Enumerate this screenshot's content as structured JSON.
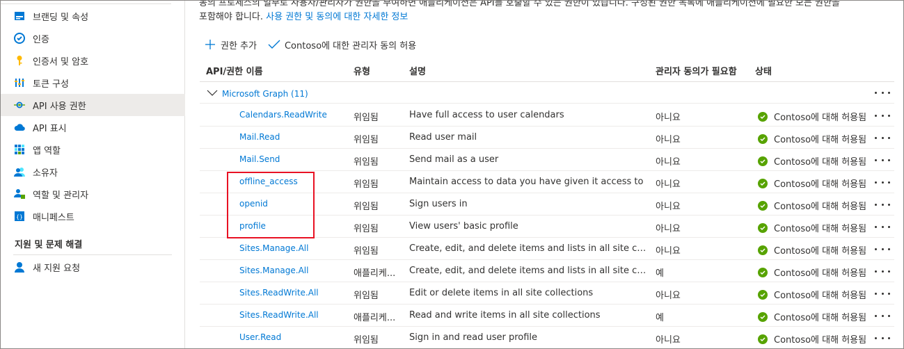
{
  "sidebar": {
    "items": [
      {
        "label": "브랜딩 및 속성",
        "icon": "branding-icon"
      },
      {
        "label": "인증",
        "icon": "authentication-icon"
      },
      {
        "label": "인증서 및 암호",
        "icon": "key-icon"
      },
      {
        "label": "토큰 구성",
        "icon": "token-configuration-icon"
      },
      {
        "label": "API 사용 권한",
        "icon": "api-permissions-icon",
        "selected": true
      },
      {
        "label": "API 표시",
        "icon": "expose-api-icon"
      },
      {
        "label": "앱 역할",
        "icon": "app-roles-icon"
      },
      {
        "label": "소유자",
        "icon": "owners-icon"
      },
      {
        "label": "역할 및 관리자",
        "icon": "roles-admins-icon"
      },
      {
        "label": "매니페스트",
        "icon": "manifest-icon"
      }
    ],
    "support_section": "지원 및 문제 해결",
    "support_items": [
      {
        "label": "새 지원 요청",
        "icon": "support-request-icon"
      }
    ]
  },
  "main": {
    "description_line1": "동의 프로세스의 일부로 사용자/관리자가 권한을 부여하면 애플리케이션은 API를 호출할 수 있는 권한이 있습니다. 구성된 권한 목록에 애플리케이션에 필요한 모든 권한을",
    "description_line2": "포함해야 합니다.",
    "description_link": "사용 권한 및 동의에 대한 자세한 정보",
    "toolbar": {
      "add_permission": "권한 추가",
      "grant_consent": "Contoso에 대한 관리자 동의 허용"
    },
    "columns": {
      "name": "API/권한 이름",
      "type": "유형",
      "description": "설명",
      "admin_consent": "관리자 동의가 필요함",
      "status": "상태"
    },
    "group": {
      "label": "Microsoft Graph (11)"
    },
    "rows": [
      {
        "name": "Calendars.ReadWrite",
        "type": "위임됨",
        "description": "Have full access to user calendars",
        "admin": "아니요",
        "status": "Contoso에 대해 허용됨"
      },
      {
        "name": "Mail.Read",
        "type": "위임됨",
        "description": "Read user mail",
        "admin": "아니요",
        "status": "Contoso에 대해 허용됨"
      },
      {
        "name": "Mail.Send",
        "type": "위임됨",
        "description": "Send mail as a user",
        "admin": "아니요",
        "status": "Contoso에 대해 허용됨"
      },
      {
        "name": "offline_access",
        "type": "위임됨",
        "description": "Maintain access to data you have given it access to",
        "admin": "아니요",
        "status": "Contoso에 대해 허용됨"
      },
      {
        "name": "openid",
        "type": "위임됨",
        "description": "Sign users in",
        "admin": "아니요",
        "status": "Contoso에 대해 허용됨"
      },
      {
        "name": "profile",
        "type": "위임됨",
        "description": "View users' basic profile",
        "admin": "아니요",
        "status": "Contoso에 대해 허용됨"
      },
      {
        "name": "Sites.Manage.All",
        "type": "위임됨",
        "description": "Create, edit, and delete items and lists in all site collecti...",
        "admin": "아니요",
        "status": "Contoso에 대해 허용됨"
      },
      {
        "name": "Sites.Manage.All",
        "type": "애플리케...",
        "description": "Create, edit, and delete items and lists in all site collecti...",
        "admin": "예",
        "status": "Contoso에 대해 허용됨"
      },
      {
        "name": "Sites.ReadWrite.All",
        "type": "위임됨",
        "description": "Edit or delete items in all site collections",
        "admin": "아니요",
        "status": "Contoso에 대해 허용됨"
      },
      {
        "name": "Sites.ReadWrite.All",
        "type": "애플리케...",
        "description": "Read and write items in all site collections",
        "admin": "예",
        "status": "Contoso에 대해 허용됨"
      },
      {
        "name": "User.Read",
        "type": "위임됨",
        "description": "Sign in and read user profile",
        "admin": "아니요",
        "status": "Contoso에 대해 허용됨"
      }
    ]
  },
  "colors": {
    "link": "#0078d4",
    "granted": "#57a300",
    "highlight_box": "#e81123",
    "selected_nav": "#edebe9"
  }
}
